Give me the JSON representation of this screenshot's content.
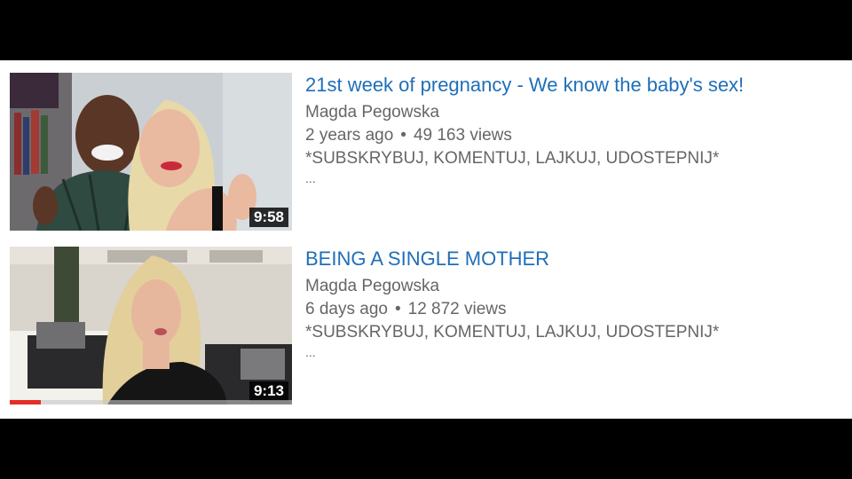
{
  "colors": {
    "title_link": "#1f6fb8",
    "meta_text": "#666666",
    "progress_red": "#e52d27",
    "background": "#ffffff",
    "letterbox": "#000000"
  },
  "videos": [
    {
      "title": "21st week of pregnancy - We know the baby's sex!",
      "channel": "Magda Pegowska",
      "age": "2 years ago",
      "separator": "•",
      "views": "49 163 views",
      "description": "*SUBSKRYBUJ, KOMENTUJ, LAJKUJ, UDOSTEPNIJ*",
      "more": "...",
      "duration": "9:58",
      "watched_fraction": 0
    },
    {
      "title": "BEING A SINGLE MOTHER",
      "channel": "Magda Pegowska",
      "age": "6 days ago",
      "separator": "•",
      "views": "12 872 views",
      "description": "*SUBSKRYBUJ, KOMENTUJ, LAJKUJ, UDOSTEPNIJ*",
      "more": "...",
      "duration": "9:13",
      "watched_fraction": 0.11
    }
  ]
}
